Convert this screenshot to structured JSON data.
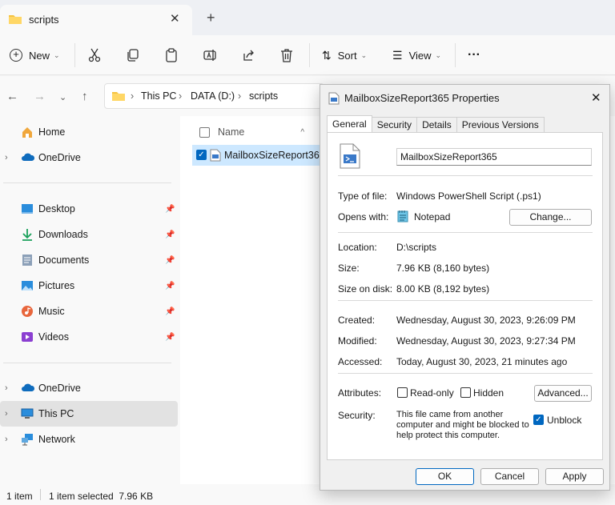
{
  "tab": {
    "title": "scripts",
    "close": "✕",
    "new_tab": "+"
  },
  "toolbar": {
    "new_label": "New",
    "sort_label": "Sort",
    "view_label": "View",
    "more": "···"
  },
  "address": {
    "crumbs": [
      "This PC",
      "DATA (D:)",
      "scripts"
    ]
  },
  "sidebar": {
    "home": "Home",
    "onedrive1": "OneDrive",
    "quick": [
      "Desktop",
      "Downloads",
      "Documents",
      "Pictures",
      "Music",
      "Videos"
    ],
    "onedrive2": "OneDrive",
    "thispc": "This PC",
    "network": "Network"
  },
  "files": {
    "column_name": "Name",
    "row_name": "MailboxSizeReport365"
  },
  "status": {
    "count": "1 item",
    "selected": "1 item selected  7.96 KB"
  },
  "dialog": {
    "title": "MailboxSizeReport365 Properties",
    "tabs": [
      "General",
      "Security",
      "Details",
      "Previous Versions"
    ],
    "filename": "MailboxSizeReport365",
    "type_label": "Type of file:",
    "type_value": "Windows PowerShell Script (.ps1)",
    "opens_label": "Opens with:",
    "opens_value": "Notepad",
    "change_button": "Change...",
    "location_label": "Location:",
    "location_value": "D:\\scripts",
    "size_label": "Size:",
    "size_value": "7.96 KB (8,160 bytes)",
    "sizeondisk_label": "Size on disk:",
    "sizeondisk_value": "8.00 KB (8,192 bytes)",
    "created_label": "Created:",
    "created_value": "Wednesday, August 30, 2023, 9:26:09 PM",
    "modified_label": "Modified:",
    "modified_value": "Wednesday, August 30, 2023, 9:27:34 PM",
    "accessed_label": "Accessed:",
    "accessed_value": "Today, August 30, 2023, 21 minutes ago",
    "attributes_label": "Attributes:",
    "readonly_label": "Read-only",
    "hidden_label": "Hidden",
    "advanced_button": "Advanced...",
    "security_label": "Security:",
    "security_line1": "This file came from another",
    "security_line2": "computer and might be blocked to",
    "security_line3": "help protect this computer.",
    "unblock_label": "Unblock",
    "ok": "OK",
    "cancel": "Cancel",
    "apply": "Apply"
  },
  "colors": {
    "accent": "#0067c0",
    "selection": "#cde8ff"
  }
}
